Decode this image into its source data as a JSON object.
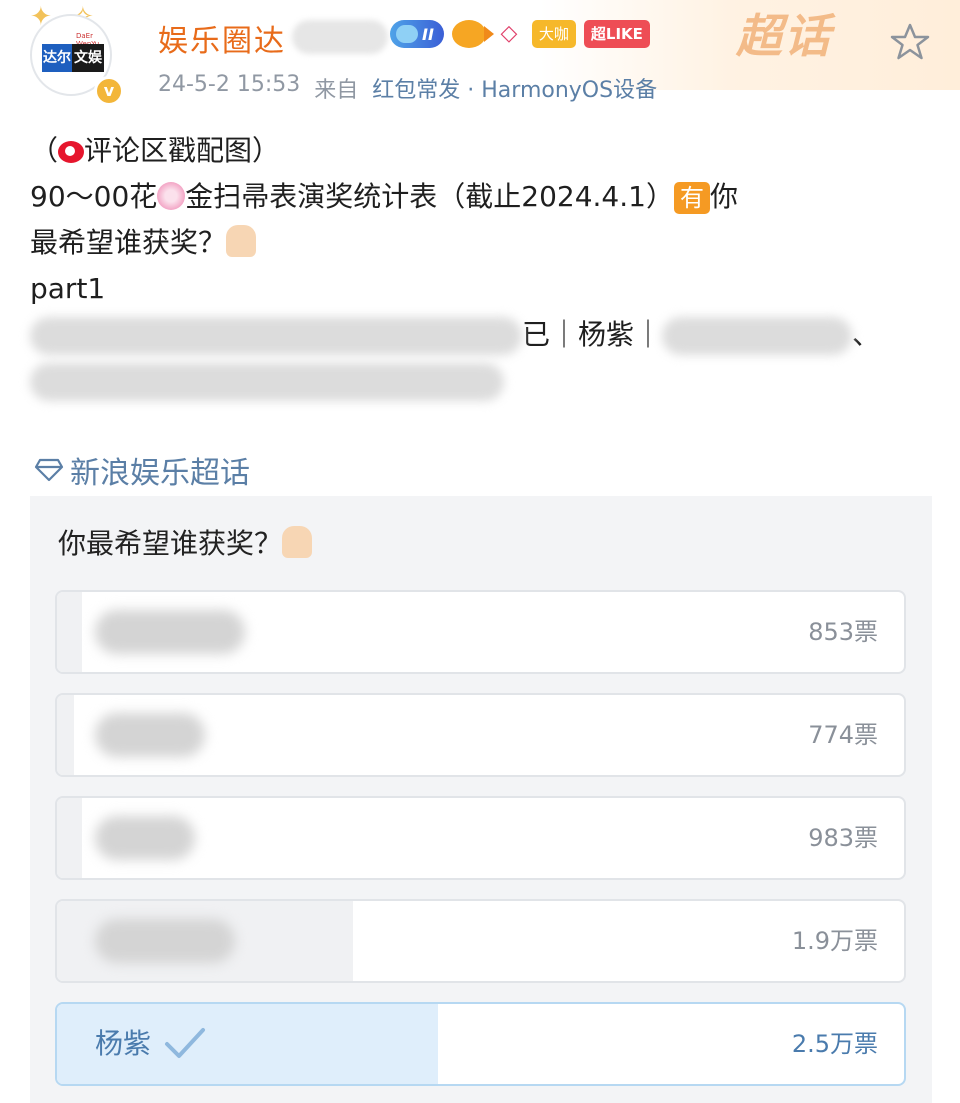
{
  "header": {
    "username": "娱乐圈达",
    "avatar_text_left": "达尔",
    "avatar_text_right": "文娱",
    "avatar_small": "DaEr WenYu",
    "verified_mark": "v",
    "level_badge": "II",
    "badge_daka": "大咖",
    "badge_like": "超LIKE",
    "supertopic_mark": "超话",
    "time": "24-5-2 15:53",
    "from": "来自",
    "device": "红包常发 · HarmonyOS设备"
  },
  "post": {
    "line1_open": "（",
    "line1_text": "评论区戳配图）",
    "line2_a": "90～00花",
    "line2_b": "金扫帚表演奖统计表（截止2024.4.1）",
    "line2_badge": "有",
    "line2_c": "你",
    "line3": "最希望谁获奖？",
    "line4": "part1",
    "line5_visible": "已｜杨紫｜",
    "line5_tail": "、"
  },
  "topic": {
    "label": "新浪娱乐超话"
  },
  "poll": {
    "question": "你最希望谁获奖？",
    "options": [
      {
        "label": "",
        "count": "853票",
        "share": 0.03,
        "voted": false
      },
      {
        "label": "",
        "count": "774票",
        "share": 0.02,
        "voted": false
      },
      {
        "label": "",
        "count": "983票",
        "share": 0.03,
        "voted": false
      },
      {
        "label": "",
        "count": "1.9万票",
        "share": 0.35,
        "voted": false
      },
      {
        "label": "杨紫",
        "count": "2.5万票",
        "share": 0.45,
        "voted": true
      }
    ]
  },
  "colors": {
    "username": "#e86b1a",
    "link": "#5b7fa6",
    "poll_voted": "#4a7bad",
    "poll_voted_fill": "#dfeefb"
  }
}
